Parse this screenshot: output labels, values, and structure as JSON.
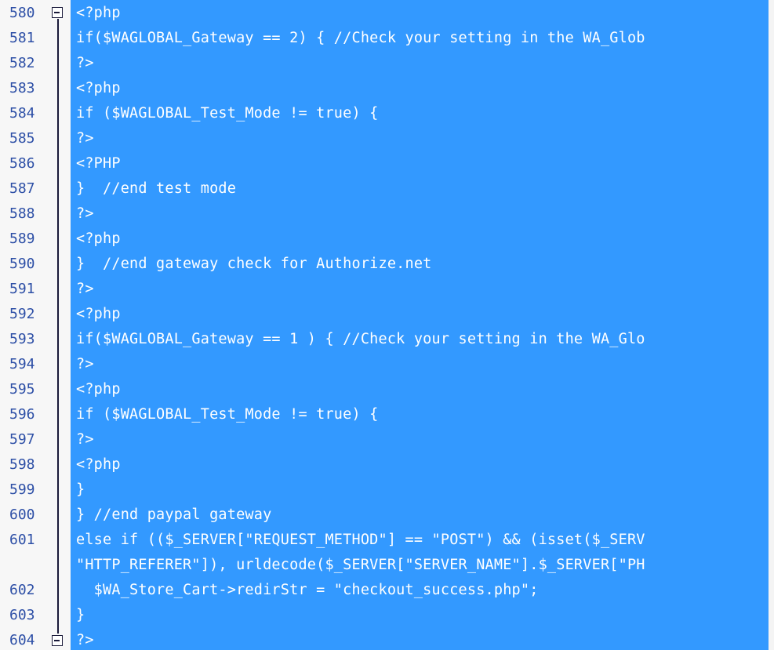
{
  "editor": {
    "colors": {
      "selection": "#3399ff",
      "gutter_bg": "#f7f7f7",
      "line_number": "#2d4fa6",
      "code_text": "#ffffff",
      "fold_marker": "#1a1a3a"
    },
    "fold_markers": [
      {
        "line": "580",
        "icon": "collapse-minus-icon"
      },
      {
        "line": "604",
        "icon": "collapse-minus-icon"
      }
    ],
    "lines": [
      {
        "num": "580",
        "code": "<?php"
      },
      {
        "num": "581",
        "code": "if($WAGLOBAL_Gateway == 2) { //Check your setting in the WA_Glob"
      },
      {
        "num": "582",
        "code": "?>"
      },
      {
        "num": "583",
        "code": "<?php"
      },
      {
        "num": "584",
        "code": "if ($WAGLOBAL_Test_Mode != true) {"
      },
      {
        "num": "585",
        "code": "?>"
      },
      {
        "num": "586",
        "code": "<?PHP"
      },
      {
        "num": "587",
        "code": "}  //end test mode"
      },
      {
        "num": "588",
        "code": "?>"
      },
      {
        "num": "589",
        "code": "<?php"
      },
      {
        "num": "590",
        "code": "}  //end gateway check for Authorize.net"
      },
      {
        "num": "591",
        "code": "?>"
      },
      {
        "num": "592",
        "code": "<?php"
      },
      {
        "num": "593",
        "code": "if($WAGLOBAL_Gateway == 1 ) { //Check your setting in the WA_Glo"
      },
      {
        "num": "594",
        "code": "?>"
      },
      {
        "num": "595",
        "code": "<?php"
      },
      {
        "num": "596",
        "code": "if ($WAGLOBAL_Test_Mode != true) {"
      },
      {
        "num": "597",
        "code": "?>"
      },
      {
        "num": "598",
        "code": "<?php"
      },
      {
        "num": "599",
        "code": "}"
      },
      {
        "num": "600",
        "code": "} //end paypal gateway"
      },
      {
        "num": "601",
        "code": "else if (($_SERVER[\"REQUEST_METHOD\"] == \"POST\") && (isset($_SERV"
      },
      {
        "num": "",
        "code": "\"HTTP_REFERER\"]), urldecode($_SERVER[\"SERVER_NAME\"].$_SERVER[\"PH"
      },
      {
        "num": "602",
        "code": "  $WA_Store_Cart->redirStr = \"checkout_success.php\";"
      },
      {
        "num": "603",
        "code": "}"
      },
      {
        "num": "604",
        "code": "?>"
      }
    ]
  }
}
